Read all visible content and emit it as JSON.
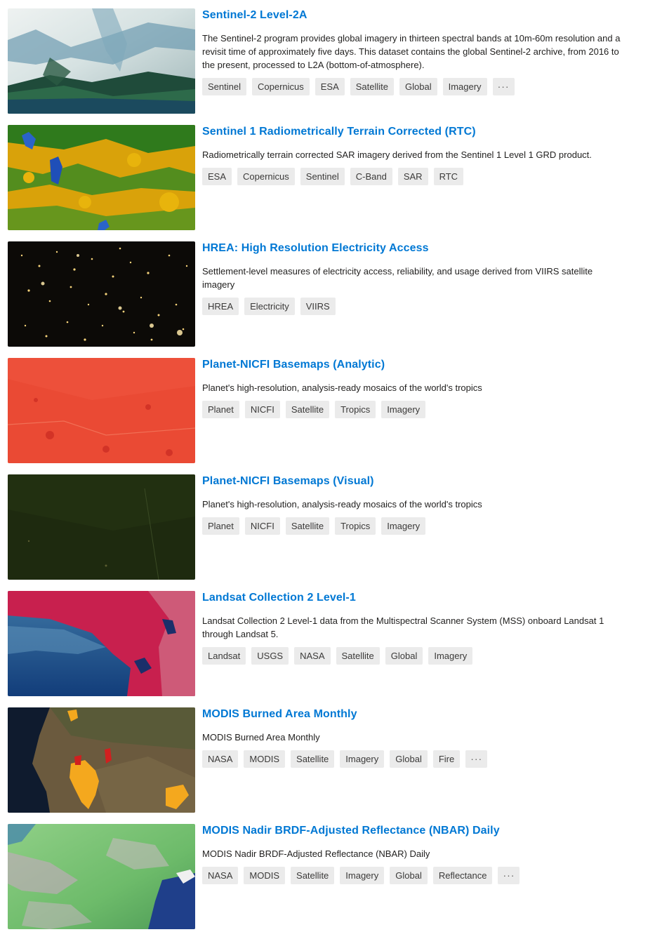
{
  "datasets": [
    {
      "title": "Sentinel-2 Level-2A",
      "description": "The Sentinel-2 program provides global imagery in thirteen spectral bands at 10m-60m resolution and a revisit time of approximately five days. This dataset contains the global Sentinel-2 archive, from 2016 to the present, processed to L2A (bottom-of-atmosphere).",
      "tags": [
        "Sentinel",
        "Copernicus",
        "ESA",
        "Satellite",
        "Global",
        "Imagery"
      ],
      "more": "···"
    },
    {
      "title": "Sentinel 1 Radiometrically Terrain Corrected (RTC)",
      "description": "Radiometrically terrain corrected SAR imagery derived from the Sentinel 1 Level 1 GRD product.",
      "tags": [
        "ESA",
        "Copernicus",
        "Sentinel",
        "C-Band",
        "SAR",
        "RTC"
      ]
    },
    {
      "title": "HREA: High Resolution Electricity Access",
      "description": "Settlement-level measures of electricity access, reliability, and usage derived from VIIRS satellite imagery",
      "tags": [
        "HREA",
        "Electricity",
        "VIIRS"
      ]
    },
    {
      "title": "Planet-NICFI Basemaps (Analytic)",
      "description": "Planet's high-resolution, analysis-ready mosaics of the world's tropics",
      "tags": [
        "Planet",
        "NICFI",
        "Satellite",
        "Tropics",
        "Imagery"
      ]
    },
    {
      "title": "Planet-NICFI Basemaps (Visual)",
      "description": "Planet's high-resolution, analysis-ready mosaics of the world's tropics",
      "tags": [
        "Planet",
        "NICFI",
        "Satellite",
        "Tropics",
        "Imagery"
      ]
    },
    {
      "title": "Landsat Collection 2 Level-1",
      "description": "Landsat Collection 2 Level-1 data from the Multispectral Scanner System (MSS) onboard Landsat 1 through Landsat 5.",
      "tags": [
        "Landsat",
        "USGS",
        "NASA",
        "Satellite",
        "Global",
        "Imagery"
      ]
    },
    {
      "title": "MODIS Burned Area Monthly",
      "description": "MODIS Burned Area Monthly",
      "tags": [
        "NASA",
        "MODIS",
        "Satellite",
        "Imagery",
        "Global",
        "Fire"
      ],
      "more": "···"
    },
    {
      "title": "MODIS Nadir BRDF-Adjusted Reflectance (NBAR) Daily",
      "description": "MODIS Nadir BRDF-Adjusted Reflectance (NBAR) Daily",
      "tags": [
        "NASA",
        "MODIS",
        "Satellite",
        "Imagery",
        "Global",
        "Reflectance"
      ],
      "more": "···"
    }
  ]
}
